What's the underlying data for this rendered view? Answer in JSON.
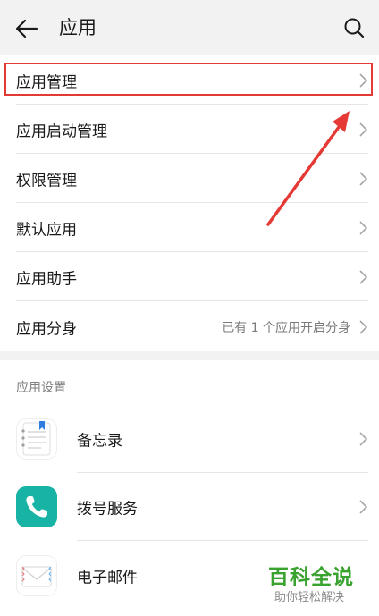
{
  "header": {
    "title": "应用",
    "back_icon": "arrow-left-icon",
    "search_icon": "search-icon"
  },
  "menu": {
    "items": [
      {
        "label": "应用管理",
        "value": ""
      },
      {
        "label": "应用启动管理",
        "value": ""
      },
      {
        "label": "权限管理",
        "value": ""
      },
      {
        "label": "默认应用",
        "value": ""
      },
      {
        "label": "应用助手",
        "value": ""
      },
      {
        "label": "应用分身",
        "value": "已有 1 个应用开启分身"
      }
    ]
  },
  "app_settings": {
    "title": "应用设置",
    "apps": [
      {
        "label": "备忘录",
        "icon": "notes-icon"
      },
      {
        "label": "拨号服务",
        "icon": "phone-icon"
      },
      {
        "label": "电子邮件",
        "icon": "mail-icon"
      }
    ]
  },
  "annotation": {
    "color": "#e53935"
  },
  "watermark": {
    "main": "百科全说",
    "sub": "助你轻松解决"
  }
}
